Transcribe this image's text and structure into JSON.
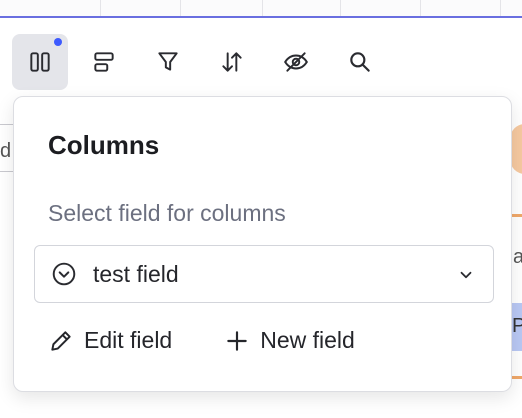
{
  "toolbar": {
    "buttons": [
      {
        "icon": "columns-icon",
        "active": true,
        "indicator": true
      },
      {
        "icon": "rows-layout-icon"
      },
      {
        "icon": "filter-icon"
      },
      {
        "icon": "sort-icon"
      },
      {
        "icon": "eye-off-icon"
      },
      {
        "icon": "search-icon"
      }
    ],
    "indicator_color": "#3d5afe"
  },
  "popover": {
    "title": "Columns",
    "label": "Select field for columns",
    "select": {
      "icon": "chevron-circle-icon",
      "value": "test field"
    },
    "edit_label": "Edit field",
    "new_label": "New field"
  },
  "background": {
    "frag_left": "d",
    "frag_right_a": "a",
    "frag_right_p": "P"
  },
  "colors": {
    "accent": "#3d5afe",
    "orange": "#f6c9a0",
    "highlight": "#b9c8f4"
  }
}
